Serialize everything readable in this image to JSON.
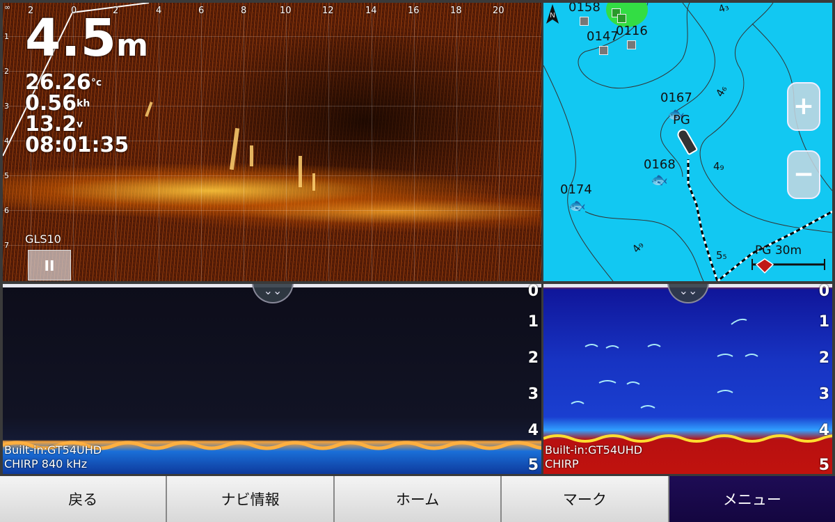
{
  "livescope": {
    "depth_value": "4.5",
    "depth_unit": "m",
    "water_temp": "26.26",
    "water_temp_unit": "°c",
    "speed": "0.56",
    "speed_unit": "kh",
    "voltage": "13.2",
    "voltage_unit": "v",
    "time": "08:01:35",
    "source_label": "GLS10",
    "pause_icon": "pause-icon",
    "top_axis": [
      "∞",
      "2",
      "0",
      "2",
      "4",
      "6",
      "8",
      "10",
      "12",
      "14",
      "16",
      "18",
      "20"
    ],
    "left_axis": [
      "1",
      "2",
      "3",
      "4",
      "5",
      "6",
      "7"
    ]
  },
  "map": {
    "waypoints": [
      {
        "label": "0158"
      },
      {
        "label": "0147"
      },
      {
        "label": "0116"
      },
      {
        "label": "0167"
      },
      {
        "label": "PG"
      },
      {
        "label": "0168"
      },
      {
        "label": "0174"
      }
    ],
    "contour_labels": [
      "4₃",
      "4₆",
      "4₉",
      "4₉",
      "5₅"
    ],
    "zoom_in_label": "+",
    "zoom_out_label": "−",
    "scale_label": "PG 30m",
    "north_icon": "north-arrow-icon",
    "colors": {
      "water": "#12c8f2",
      "land": "#33dd44"
    }
  },
  "sonar_left": {
    "scale": [
      "0",
      "1",
      "2",
      "3",
      "4",
      "5"
    ],
    "source_line1": "Built-in:GT54UHD",
    "source_line2": "CHIRP 840 kHz"
  },
  "sonar_right": {
    "scale": [
      "0",
      "1",
      "2",
      "3",
      "4",
      "5"
    ],
    "source_line1": "Built-in:GT54UHD",
    "source_line2": "CHIRP"
  },
  "nav": {
    "back": "戻る",
    "nav_info": "ナビ情報",
    "home": "ホーム",
    "mark": "マーク",
    "menu": "メニュー"
  }
}
